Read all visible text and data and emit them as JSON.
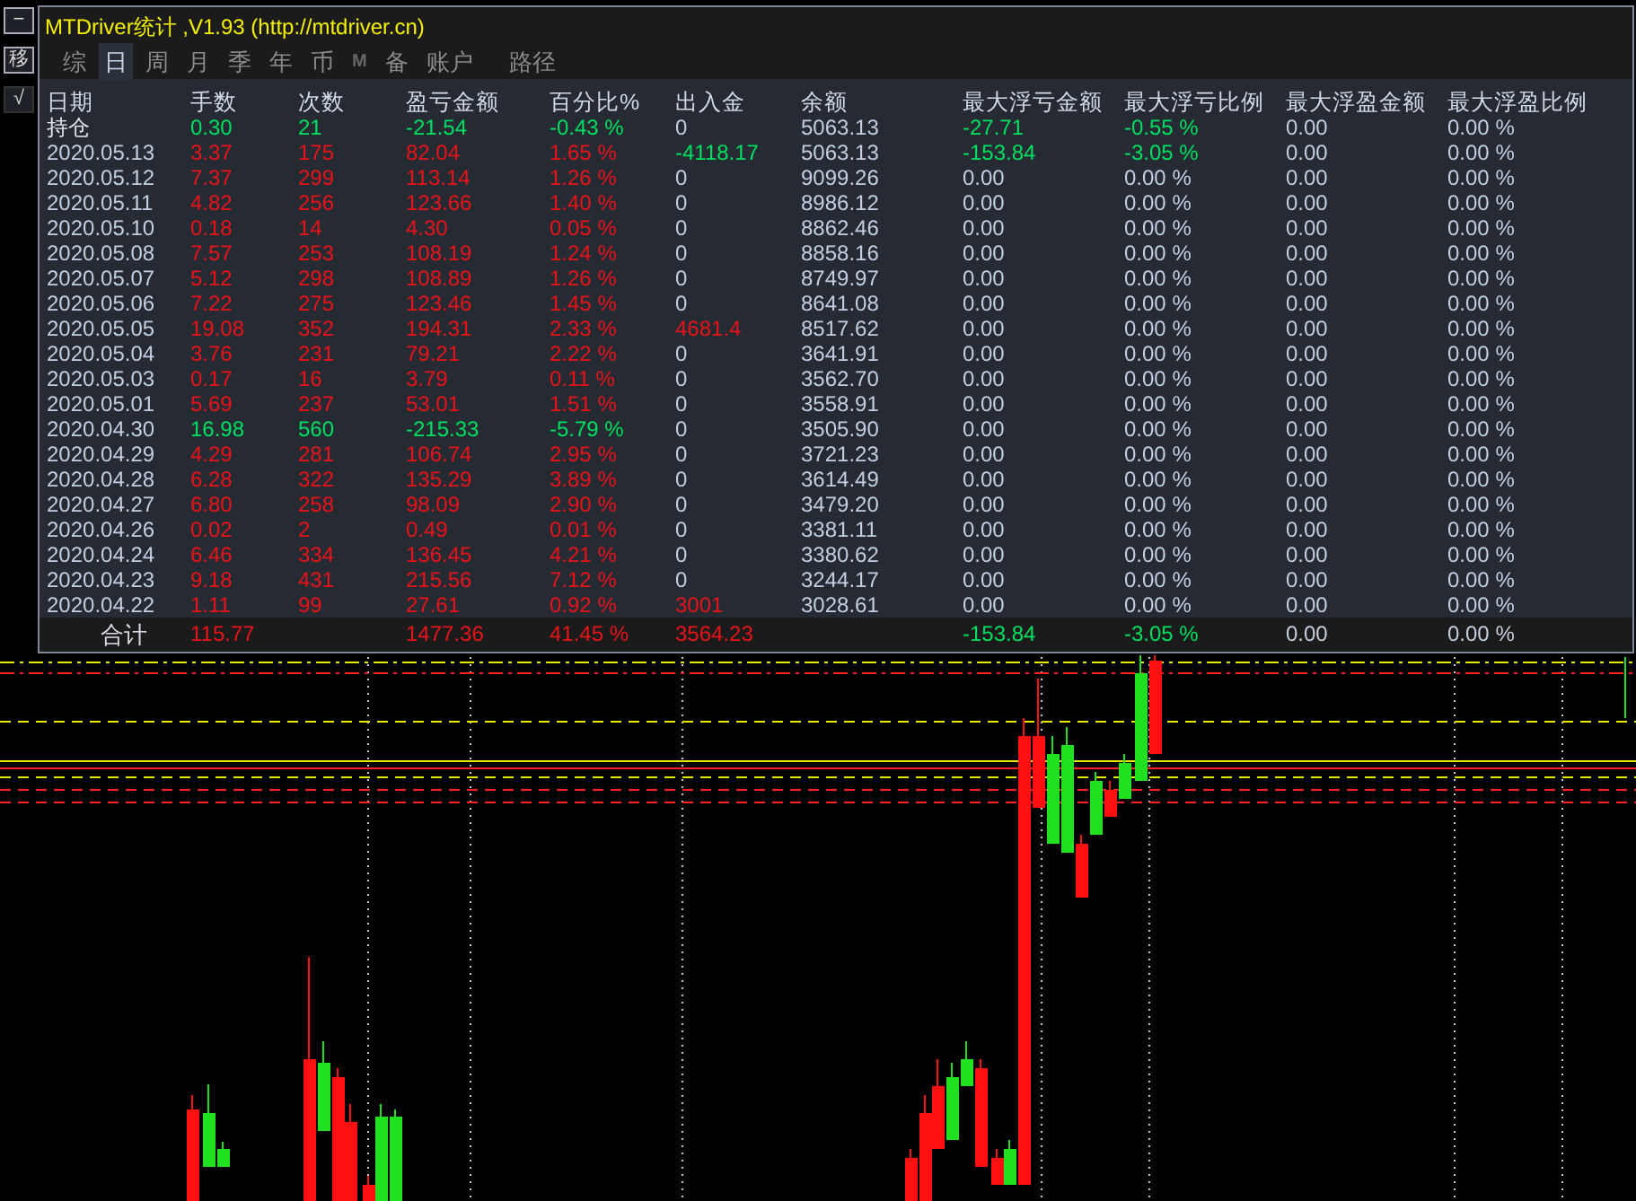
{
  "side_buttons": [
    "−",
    "移",
    "√"
  ],
  "window": {
    "title": "MTDriver统计 ,V1.93 (http://mtdriver.cn)"
  },
  "tabs": [
    {
      "label": "综",
      "selected": false,
      "kind": "text"
    },
    {
      "label": "日",
      "selected": true,
      "kind": "text"
    },
    {
      "label": "周",
      "selected": false,
      "kind": "text"
    },
    {
      "label": "月",
      "selected": false,
      "kind": "text"
    },
    {
      "label": "季",
      "selected": false,
      "kind": "text"
    },
    {
      "label": "年",
      "selected": false,
      "kind": "text"
    },
    {
      "label": "币",
      "selected": false,
      "kind": "text"
    },
    {
      "label": "M",
      "selected": false,
      "kind": "mark"
    },
    {
      "label": "备",
      "selected": false,
      "kind": "text"
    },
    {
      "label": "账户",
      "selected": false,
      "kind": "text"
    },
    {
      "label": "路径",
      "selected": false,
      "kind": "text"
    }
  ],
  "table": {
    "columns": [
      "日期",
      "手数",
      "次数",
      "盈亏金额",
      "百分比%",
      "出入金",
      "余额",
      "最大浮亏金额",
      "最大浮亏比例",
      "最大浮盈金额",
      "最大浮盈比例"
    ],
    "rows": [
      {
        "cells": [
          {
            "text": "持仓",
            "color": "#e0e6ee"
          },
          {
            "text": "0.30",
            "color": "#00e060"
          },
          {
            "text": "21",
            "color": "#00e060"
          },
          {
            "text": "-21.54",
            "color": "#00e060"
          },
          {
            "text": "-0.43 %",
            "color": "#00e060"
          },
          {
            "text": "0",
            "color": "#c3cfe0"
          },
          {
            "text": "5063.13",
            "color": "#c3cfe0"
          },
          {
            "text": "-27.71",
            "color": "#00e060"
          },
          {
            "text": "-0.55 %",
            "color": "#00e060"
          },
          {
            "text": "0.00",
            "color": "#c3cfe0"
          },
          {
            "text": "0.00 %",
            "color": "#c3cfe0"
          }
        ]
      },
      {
        "cells": [
          {
            "text": "2020.05.13",
            "color": "#c3cfe0"
          },
          {
            "text": "3.37",
            "color": "#e8141a"
          },
          {
            "text": "175",
            "color": "#e8141a"
          },
          {
            "text": "82.04",
            "color": "#e8141a"
          },
          {
            "text": "1.65 %",
            "color": "#e8141a"
          },
          {
            "text": "-4118.17",
            "color": "#00e060"
          },
          {
            "text": "5063.13",
            "color": "#c3cfe0"
          },
          {
            "text": "-153.84",
            "color": "#00e060"
          },
          {
            "text": "-3.05 %",
            "color": "#00e060"
          },
          {
            "text": "0.00",
            "color": "#c3cfe0"
          },
          {
            "text": "0.00 %",
            "color": "#c3cfe0"
          }
        ]
      },
      {
        "cells": [
          {
            "text": "2020.05.12",
            "color": "#c3cfe0"
          },
          {
            "text": "7.37",
            "color": "#e8141a"
          },
          {
            "text": "299",
            "color": "#e8141a"
          },
          {
            "text": "113.14",
            "color": "#e8141a"
          },
          {
            "text": "1.26 %",
            "color": "#e8141a"
          },
          {
            "text": "0",
            "color": "#c3cfe0"
          },
          {
            "text": "9099.26",
            "color": "#c3cfe0"
          },
          {
            "text": "0.00",
            "color": "#c3cfe0"
          },
          {
            "text": "0.00 %",
            "color": "#c3cfe0"
          },
          {
            "text": "0.00",
            "color": "#c3cfe0"
          },
          {
            "text": "0.00 %",
            "color": "#c3cfe0"
          }
        ]
      },
      {
        "cells": [
          {
            "text": "2020.05.11",
            "color": "#c3cfe0"
          },
          {
            "text": "4.82",
            "color": "#e8141a"
          },
          {
            "text": "256",
            "color": "#e8141a"
          },
          {
            "text": "123.66",
            "color": "#e8141a"
          },
          {
            "text": "1.40 %",
            "color": "#e8141a"
          },
          {
            "text": "0",
            "color": "#c3cfe0"
          },
          {
            "text": "8986.12",
            "color": "#c3cfe0"
          },
          {
            "text": "0.00",
            "color": "#c3cfe0"
          },
          {
            "text": "0.00 %",
            "color": "#c3cfe0"
          },
          {
            "text": "0.00",
            "color": "#c3cfe0"
          },
          {
            "text": "0.00 %",
            "color": "#c3cfe0"
          }
        ]
      },
      {
        "cells": [
          {
            "text": "2020.05.10",
            "color": "#c3cfe0"
          },
          {
            "text": "0.18",
            "color": "#e8141a"
          },
          {
            "text": "14",
            "color": "#e8141a"
          },
          {
            "text": "4.30",
            "color": "#e8141a"
          },
          {
            "text": "0.05 %",
            "color": "#e8141a"
          },
          {
            "text": "0",
            "color": "#c3cfe0"
          },
          {
            "text": "8862.46",
            "color": "#c3cfe0"
          },
          {
            "text": "0.00",
            "color": "#c3cfe0"
          },
          {
            "text": "0.00 %",
            "color": "#c3cfe0"
          },
          {
            "text": "0.00",
            "color": "#c3cfe0"
          },
          {
            "text": "0.00 %",
            "color": "#c3cfe0"
          }
        ]
      },
      {
        "cells": [
          {
            "text": "2020.05.08",
            "color": "#c3cfe0"
          },
          {
            "text": "7.57",
            "color": "#e8141a"
          },
          {
            "text": "253",
            "color": "#e8141a"
          },
          {
            "text": "108.19",
            "color": "#e8141a"
          },
          {
            "text": "1.24 %",
            "color": "#e8141a"
          },
          {
            "text": "0",
            "color": "#c3cfe0"
          },
          {
            "text": "8858.16",
            "color": "#c3cfe0"
          },
          {
            "text": "0.00",
            "color": "#c3cfe0"
          },
          {
            "text": "0.00 %",
            "color": "#c3cfe0"
          },
          {
            "text": "0.00",
            "color": "#c3cfe0"
          },
          {
            "text": "0.00 %",
            "color": "#c3cfe0"
          }
        ]
      },
      {
        "cells": [
          {
            "text": "2020.05.07",
            "color": "#c3cfe0"
          },
          {
            "text": "5.12",
            "color": "#e8141a"
          },
          {
            "text": "298",
            "color": "#e8141a"
          },
          {
            "text": "108.89",
            "color": "#e8141a"
          },
          {
            "text": "1.26 %",
            "color": "#e8141a"
          },
          {
            "text": "0",
            "color": "#c3cfe0"
          },
          {
            "text": "8749.97",
            "color": "#c3cfe0"
          },
          {
            "text": "0.00",
            "color": "#c3cfe0"
          },
          {
            "text": "0.00 %",
            "color": "#c3cfe0"
          },
          {
            "text": "0.00",
            "color": "#c3cfe0"
          },
          {
            "text": "0.00 %",
            "color": "#c3cfe0"
          }
        ]
      },
      {
        "cells": [
          {
            "text": "2020.05.06",
            "color": "#c3cfe0"
          },
          {
            "text": "7.22",
            "color": "#e8141a"
          },
          {
            "text": "275",
            "color": "#e8141a"
          },
          {
            "text": "123.46",
            "color": "#e8141a"
          },
          {
            "text": "1.45 %",
            "color": "#e8141a"
          },
          {
            "text": "0",
            "color": "#c3cfe0"
          },
          {
            "text": "8641.08",
            "color": "#c3cfe0"
          },
          {
            "text": "0.00",
            "color": "#c3cfe0"
          },
          {
            "text": "0.00 %",
            "color": "#c3cfe0"
          },
          {
            "text": "0.00",
            "color": "#c3cfe0"
          },
          {
            "text": "0.00 %",
            "color": "#c3cfe0"
          }
        ]
      },
      {
        "cells": [
          {
            "text": "2020.05.05",
            "color": "#c3cfe0"
          },
          {
            "text": "19.08",
            "color": "#e8141a"
          },
          {
            "text": "352",
            "color": "#e8141a"
          },
          {
            "text": "194.31",
            "color": "#e8141a"
          },
          {
            "text": "2.33 %",
            "color": "#e8141a"
          },
          {
            "text": "4681.4",
            "color": "#e8141a"
          },
          {
            "text": "8517.62",
            "color": "#c3cfe0"
          },
          {
            "text": "0.00",
            "color": "#c3cfe0"
          },
          {
            "text": "0.00 %",
            "color": "#c3cfe0"
          },
          {
            "text": "0.00",
            "color": "#c3cfe0"
          },
          {
            "text": "0.00 %",
            "color": "#c3cfe0"
          }
        ]
      },
      {
        "cells": [
          {
            "text": "2020.05.04",
            "color": "#c3cfe0"
          },
          {
            "text": "3.76",
            "color": "#e8141a"
          },
          {
            "text": "231",
            "color": "#e8141a"
          },
          {
            "text": "79.21",
            "color": "#e8141a"
          },
          {
            "text": "2.22 %",
            "color": "#e8141a"
          },
          {
            "text": "0",
            "color": "#c3cfe0"
          },
          {
            "text": "3641.91",
            "color": "#c3cfe0"
          },
          {
            "text": "0.00",
            "color": "#c3cfe0"
          },
          {
            "text": "0.00 %",
            "color": "#c3cfe0"
          },
          {
            "text": "0.00",
            "color": "#c3cfe0"
          },
          {
            "text": "0.00 %",
            "color": "#c3cfe0"
          }
        ]
      },
      {
        "cells": [
          {
            "text": "2020.05.03",
            "color": "#c3cfe0"
          },
          {
            "text": "0.17",
            "color": "#e8141a"
          },
          {
            "text": "16",
            "color": "#e8141a"
          },
          {
            "text": "3.79",
            "color": "#e8141a"
          },
          {
            "text": "0.11 %",
            "color": "#e8141a"
          },
          {
            "text": "0",
            "color": "#c3cfe0"
          },
          {
            "text": "3562.70",
            "color": "#c3cfe0"
          },
          {
            "text": "0.00",
            "color": "#c3cfe0"
          },
          {
            "text": "0.00 %",
            "color": "#c3cfe0"
          },
          {
            "text": "0.00",
            "color": "#c3cfe0"
          },
          {
            "text": "0.00 %",
            "color": "#c3cfe0"
          }
        ]
      },
      {
        "cells": [
          {
            "text": "2020.05.01",
            "color": "#c3cfe0"
          },
          {
            "text": "5.69",
            "color": "#e8141a"
          },
          {
            "text": "237",
            "color": "#e8141a"
          },
          {
            "text": "53.01",
            "color": "#e8141a"
          },
          {
            "text": "1.51 %",
            "color": "#e8141a"
          },
          {
            "text": "0",
            "color": "#c3cfe0"
          },
          {
            "text": "3558.91",
            "color": "#c3cfe0"
          },
          {
            "text": "0.00",
            "color": "#c3cfe0"
          },
          {
            "text": "0.00 %",
            "color": "#c3cfe0"
          },
          {
            "text": "0.00",
            "color": "#c3cfe0"
          },
          {
            "text": "0.00 %",
            "color": "#c3cfe0"
          }
        ]
      },
      {
        "cells": [
          {
            "text": "2020.04.30",
            "color": "#c3cfe0"
          },
          {
            "text": "16.98",
            "color": "#00e060"
          },
          {
            "text": "560",
            "color": "#00e060"
          },
          {
            "text": "-215.33",
            "color": "#00e060"
          },
          {
            "text": "-5.79 %",
            "color": "#00e060"
          },
          {
            "text": "0",
            "color": "#c3cfe0"
          },
          {
            "text": "3505.90",
            "color": "#c3cfe0"
          },
          {
            "text": "0.00",
            "color": "#c3cfe0"
          },
          {
            "text": "0.00 %",
            "color": "#c3cfe0"
          },
          {
            "text": "0.00",
            "color": "#c3cfe0"
          },
          {
            "text": "0.00 %",
            "color": "#c3cfe0"
          }
        ]
      },
      {
        "cells": [
          {
            "text": "2020.04.29",
            "color": "#c3cfe0"
          },
          {
            "text": "4.29",
            "color": "#e8141a"
          },
          {
            "text": "281",
            "color": "#e8141a"
          },
          {
            "text": "106.74",
            "color": "#e8141a"
          },
          {
            "text": "2.95 %",
            "color": "#e8141a"
          },
          {
            "text": "0",
            "color": "#c3cfe0"
          },
          {
            "text": "3721.23",
            "color": "#c3cfe0"
          },
          {
            "text": "0.00",
            "color": "#c3cfe0"
          },
          {
            "text": "0.00 %",
            "color": "#c3cfe0"
          },
          {
            "text": "0.00",
            "color": "#c3cfe0"
          },
          {
            "text": "0.00 %",
            "color": "#c3cfe0"
          }
        ]
      },
      {
        "cells": [
          {
            "text": "2020.04.28",
            "color": "#c3cfe0"
          },
          {
            "text": "6.28",
            "color": "#e8141a"
          },
          {
            "text": "322",
            "color": "#e8141a"
          },
          {
            "text": "135.29",
            "color": "#e8141a"
          },
          {
            "text": "3.89 %",
            "color": "#e8141a"
          },
          {
            "text": "0",
            "color": "#c3cfe0"
          },
          {
            "text": "3614.49",
            "color": "#c3cfe0"
          },
          {
            "text": "0.00",
            "color": "#c3cfe0"
          },
          {
            "text": "0.00 %",
            "color": "#c3cfe0"
          },
          {
            "text": "0.00",
            "color": "#c3cfe0"
          },
          {
            "text": "0.00 %",
            "color": "#c3cfe0"
          }
        ]
      },
      {
        "cells": [
          {
            "text": "2020.04.27",
            "color": "#c3cfe0"
          },
          {
            "text": "6.80",
            "color": "#e8141a"
          },
          {
            "text": "258",
            "color": "#e8141a"
          },
          {
            "text": "98.09",
            "color": "#e8141a"
          },
          {
            "text": "2.90 %",
            "color": "#e8141a"
          },
          {
            "text": "0",
            "color": "#c3cfe0"
          },
          {
            "text": "3479.20",
            "color": "#c3cfe0"
          },
          {
            "text": "0.00",
            "color": "#c3cfe0"
          },
          {
            "text": "0.00 %",
            "color": "#c3cfe0"
          },
          {
            "text": "0.00",
            "color": "#c3cfe0"
          },
          {
            "text": "0.00 %",
            "color": "#c3cfe0"
          }
        ]
      },
      {
        "cells": [
          {
            "text": "2020.04.26",
            "color": "#c3cfe0"
          },
          {
            "text": "0.02",
            "color": "#e8141a"
          },
          {
            "text": "2",
            "color": "#e8141a"
          },
          {
            "text": "0.49",
            "color": "#e8141a"
          },
          {
            "text": "0.01 %",
            "color": "#e8141a"
          },
          {
            "text": "0",
            "color": "#c3cfe0"
          },
          {
            "text": "3381.11",
            "color": "#c3cfe0"
          },
          {
            "text": "0.00",
            "color": "#c3cfe0"
          },
          {
            "text": "0.00 %",
            "color": "#c3cfe0"
          },
          {
            "text": "0.00",
            "color": "#c3cfe0"
          },
          {
            "text": "0.00 %",
            "color": "#c3cfe0"
          }
        ]
      },
      {
        "cells": [
          {
            "text": "2020.04.24",
            "color": "#c3cfe0"
          },
          {
            "text": "6.46",
            "color": "#e8141a"
          },
          {
            "text": "334",
            "color": "#e8141a"
          },
          {
            "text": "136.45",
            "color": "#e8141a"
          },
          {
            "text": "4.21 %",
            "color": "#e8141a"
          },
          {
            "text": "0",
            "color": "#c3cfe0"
          },
          {
            "text": "3380.62",
            "color": "#c3cfe0"
          },
          {
            "text": "0.00",
            "color": "#c3cfe0"
          },
          {
            "text": "0.00 %",
            "color": "#c3cfe0"
          },
          {
            "text": "0.00",
            "color": "#c3cfe0"
          },
          {
            "text": "0.00 %",
            "color": "#c3cfe0"
          }
        ]
      },
      {
        "cells": [
          {
            "text": "2020.04.23",
            "color": "#c3cfe0"
          },
          {
            "text": "9.18",
            "color": "#e8141a"
          },
          {
            "text": "431",
            "color": "#e8141a"
          },
          {
            "text": "215.56",
            "color": "#e8141a"
          },
          {
            "text": "7.12 %",
            "color": "#e8141a"
          },
          {
            "text": "0",
            "color": "#c3cfe0"
          },
          {
            "text": "3244.17",
            "color": "#c3cfe0"
          },
          {
            "text": "0.00",
            "color": "#c3cfe0"
          },
          {
            "text": "0.00 %",
            "color": "#c3cfe0"
          },
          {
            "text": "0.00",
            "color": "#c3cfe0"
          },
          {
            "text": "0.00 %",
            "color": "#c3cfe0"
          }
        ]
      },
      {
        "cells": [
          {
            "text": "2020.04.22",
            "color": "#c3cfe0"
          },
          {
            "text": "1.11",
            "color": "#e8141a"
          },
          {
            "text": "99",
            "color": "#e8141a"
          },
          {
            "text": "27.61",
            "color": "#e8141a"
          },
          {
            "text": "0.92 %",
            "color": "#e8141a"
          },
          {
            "text": "3001",
            "color": "#e8141a"
          },
          {
            "text": "3028.61",
            "color": "#c3cfe0"
          },
          {
            "text": "0.00",
            "color": "#c3cfe0"
          },
          {
            "text": "0.00 %",
            "color": "#c3cfe0"
          },
          {
            "text": "0.00",
            "color": "#c3cfe0"
          },
          {
            "text": "0.00 %",
            "color": "#c3cfe0"
          }
        ]
      }
    ],
    "footer": {
      "cells": [
        {
          "text": "合计",
          "color": "#d8dde5"
        },
        {
          "text": "115.77",
          "color": "#e8141a"
        },
        null,
        {
          "text": "1477.36",
          "color": "#e8141a"
        },
        {
          "text": "41.45 %",
          "color": "#e8141a"
        },
        {
          "text": "3564.23",
          "color": "#e8141a"
        },
        null,
        {
          "text": "-153.84",
          "color": "#00e060"
        },
        {
          "text": "-3.05 %",
          "color": "#00e060"
        },
        {
          "text": "0.00",
          "color": "#c3cfe0"
        },
        {
          "text": "0.00 %",
          "color": "#c3cfe0"
        }
      ]
    }
  }
}
